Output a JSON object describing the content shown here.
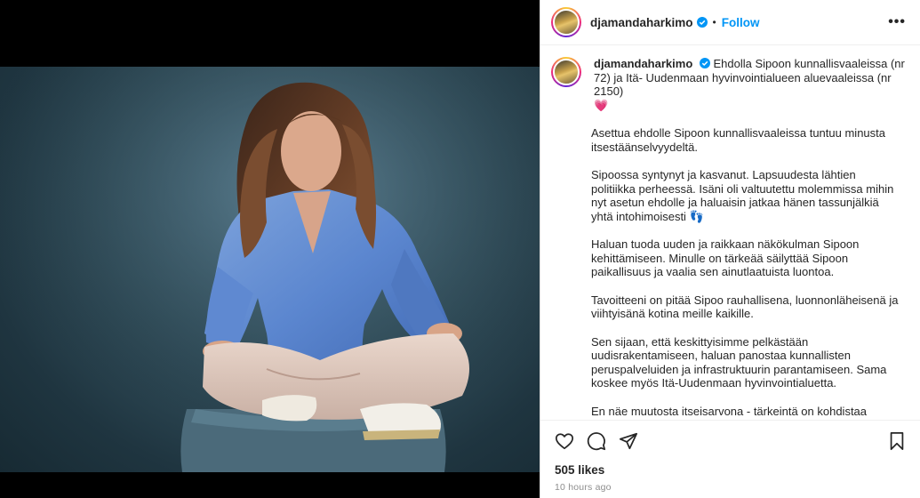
{
  "post": {
    "username": "djamandaharkimo",
    "dot": "•",
    "follow_label": "Follow",
    "more_label": "•••",
    "verified_icon": "verified-badge-icon",
    "accent": "#0095f6"
  },
  "caption": {
    "username": "djamandaharkimo",
    "first_line": "Ehdolla Sipoon kunnallisvaaleissa (nr 72) ja Itä- Uudenmaan hyvinvointialueen aluevaaleissa (nr 2150)",
    "first_emoji": "💗",
    "paragraphs": [
      "Asettua ehdolle Sipoon kunnallisvaaleissa tuntuu minusta itsestäänselvyydeltä.",
      "Sipoossa syntynyt ja kasvanut. Lapsuudesta lähtien politiikka perheessä. Isäni oli valtuutettu molemmissa mihin nyt asetun ehdolle ja haluaisin jatkaa hänen tassunjälkiä yhtä intohimoisesti 👣",
      "Haluan tuoda uuden ja raikkaan näkökulman Sipoon kehittämiseen. Minulle on tärkeää säilyttää Sipoon paikallisuus ja vaalia sen ainutlaatuista luontoa.",
      "Tavoitteeni on pitää Sipoo rauhallisena, luonnonläheisenä ja viihtyisänä kotina meille kaikille.",
      "Sen sijaan, että keskittyisimme pelkästään uudisrakentamiseen, haluan panostaa kunnallisten peruspalveluiden ja infrastruktuurin parantamiseen. Sama koskee myös Itä-Uudenmaan hyvinvointialuetta.",
      "En näe muutosta itseisarvona - tärkeintä on kohdistaa resurssit sinne, missä niitä eniten tarvitaan."
    ]
  },
  "actions": {
    "icons": [
      "heart-icon",
      "comment-icon",
      "share-icon",
      "bookmark-icon"
    ],
    "likes": "505 likes",
    "time": "10 hours ago"
  }
}
